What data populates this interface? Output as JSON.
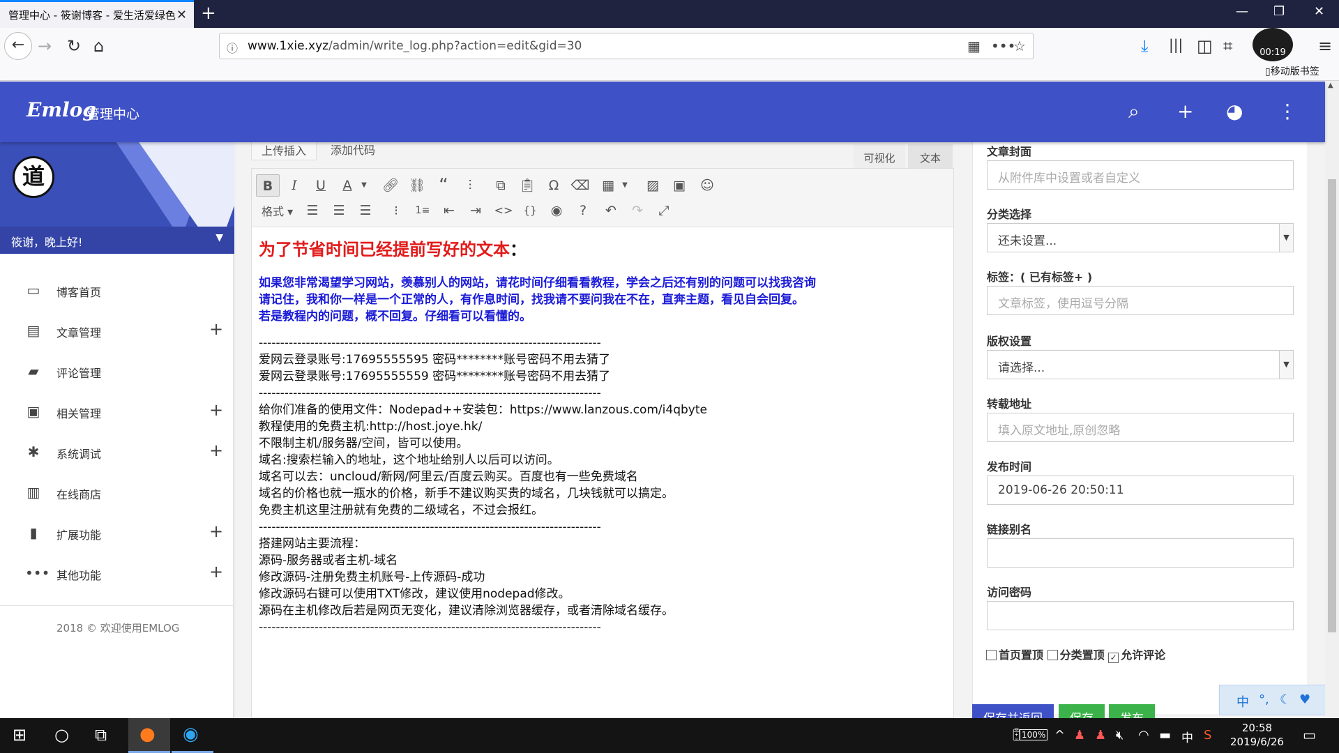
{
  "browser": {
    "tab_title": "管理中心 - 筱谢博客 - 爱生活爱绿色",
    "url_host": "www.1xie.xyz",
    "url_path": "/admin/write_log.php?action=edit&gid=30",
    "mobile_bookmarks": "移动版书签",
    "timer": "00:19"
  },
  "header": {
    "brand": "Emlog",
    "subtitle": "管理中心"
  },
  "sidebar": {
    "avatar_char": "道",
    "greeting": "筱谢，晚上好!",
    "items": [
      {
        "label": "博客首页",
        "icon": "monitor-icon",
        "expandable": false
      },
      {
        "label": "文章管理",
        "icon": "clipboard-icon",
        "expandable": true
      },
      {
        "label": "评论管理",
        "icon": "comment-icon",
        "expandable": false
      },
      {
        "label": "相关管理",
        "icon": "id-card-icon",
        "expandable": true
      },
      {
        "label": "系统调试",
        "icon": "bug-icon",
        "expandable": true
      },
      {
        "label": "在线商店",
        "icon": "store-icon",
        "expandable": false
      },
      {
        "label": "扩展功能",
        "icon": "extension-icon",
        "expandable": true
      },
      {
        "label": "其他功能",
        "icon": "more-icon",
        "expandable": true
      }
    ],
    "footer": "2018 © 欢迎使用EMLOG"
  },
  "editor": {
    "upload_btn": "上传插入",
    "code_btn": "添加代码",
    "tab_visual": "可视化",
    "tab_text": "文本",
    "format_label": "格式",
    "heading": "为了节省时间已经提前写好的文本",
    "heading_colon": "：",
    "blue_lines": [
      "如果您非常渴望学习网站，羡慕别人的网站，请花时间仔细看看教程，学会之后还有别的问题可以找我咨询",
      "请记住，我和你一样是一个正常的人，有作息时间，找我请不要问我在不在，直奔主题，看见自会回复。",
      "若是教程内的问题，概不回复。仔细看可以看懂的。"
    ],
    "divider": "--------------------------------------------------------------------------------",
    "block1": [
      "爱网云登录账号:17695555595 密码********账号密码不用去猜了",
      "爱网云登录账号:17695555559 密码********账号密码不用去猜了"
    ],
    "block2": [
      "给你们准备的使用文件：Nodepad++安装包：https://www.lanzous.com/i4qbyte",
      "教程使用的免费主机:http://host.joye.hk/",
      "不限制主机/服务器/空间，皆可以使用。",
      "域名:搜索栏输入的地址，这个地址给别人以后可以访问。",
      "域名可以去：uncloud/新网/阿里云/百度云购买。百度也有一些免费域名",
      "域名的价格也就一瓶水的价格，新手不建议购买贵的域名，几块钱就可以搞定。",
      "免费主机这里注册就有免费的二级域名，不过会报红。"
    ],
    "block3": [
      "搭建网站主要流程：",
      "源码-服务器或者主机-域名",
      "修改源码-注册免费主机账号-上传源码-成功",
      "修改源码右键可以使用TXT修改，建议使用nodepad修改。",
      "源码在主机修改后若是网页无变化，建议清除浏览器缓存，或者清除域名缓存。"
    ]
  },
  "panel": {
    "cover_label": "文章封面",
    "cover_placeholder": "从附件库中设置或者自定义",
    "category_label": "分类选择",
    "category_value": "还未设置...",
    "tags_label": "标签：( 已有标签+ )",
    "tags_placeholder": "文章标签，使用逗号分隔",
    "copyright_label": "版权设置",
    "copyright_value": "请选择...",
    "repost_label": "转载地址",
    "repost_placeholder": "填入原文地址,原创忽略",
    "time_label": "发布时间",
    "time_value": "2019-06-26 20:50:11",
    "alias_label": "链接别名",
    "password_label": "访问密码",
    "chk_home": "首页置顶",
    "chk_category": "分类置顶",
    "chk_comment": "允许评论",
    "chk_comment_checked": true,
    "btn_save_return": "保存并返回",
    "btn_save": "保存",
    "btn_publish": "发布"
  },
  "taskbar": {
    "time": "20:58",
    "date": "2019/6/26",
    "battery": "100%",
    "ime_lang": "中"
  },
  "colors": {
    "header_bg": "#3f51c6",
    "accent_green": "#3cb34a",
    "accent_blue": "#3f51c6"
  }
}
